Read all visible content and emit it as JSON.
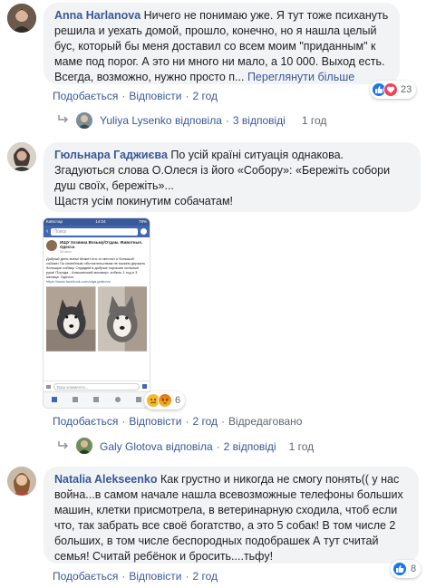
{
  "comments": [
    {
      "author": "Anna Harlanova",
      "text": "Ничего не понимаю уже. Я тут тоже психануть решила и уехать домой, прошло, конечно, но я нашла целый бус, который бы меня доставил со всем моим \"приданным\" к маме под порог. А это ни много ни мало, а 10 000. Выход есть. Всегда, возможно, нужно просто п...",
      "see_more": "Переглянути більше",
      "like": "Подобається",
      "reply": "Відповісти",
      "time": "2 год",
      "reactions_count": "23",
      "reactions": [
        "like-icon",
        "love-icon"
      ],
      "replies": {
        "replier": "Yuliya Lysenko",
        "verb": "відповіла",
        "count": "3 відповіді",
        "time": "1 год"
      }
    },
    {
      "author": "Гюльнара Гаджиєва",
      "text_lines": [
        "По усій країні ситуація однакова.",
        "Згадуються слова О.Олеся із його «Собору»: «Бережіть собори душ своїх, бережіть»...",
        "Щастя усім покинутим собачатам!"
      ],
      "like": "Подобається",
      "reply": "Відповісти",
      "time": "2 год",
      "edited": "Відредаговано",
      "reactions_count": "6",
      "reactions": [
        "sad-icon",
        "angry-icon"
      ],
      "screenshot": {
        "status_left": "Київстар",
        "status_time": "14:04",
        "status_right": "78%",
        "search": "Поиск",
        "group_title": "ИЩУ Хозяина Возьму/Отдам. Животные. Одесса",
        "post_time": "26 мин",
        "post_text": "Добрый день всем! Может кто-то мечтал о большой собаке! По семейным обстоятельствам не можем держать большую собаку. Отдадим в добрые хорошие сильные руки! Порода - Аляскинский маламут, кобель 1 год и 3 месяца. Одесса.",
        "post_link": "https://www.facebook.com/olga.grabova",
        "comment_placeholder": "Ваш коммента..."
      },
      "replies": {
        "replier": "Galy Glotova",
        "verb": "відповіла",
        "count": "2 відповіді",
        "time": "1 год"
      }
    },
    {
      "author": "Natalia Alekseenko",
      "text": "Как грустно и никогда не смогу понять(( у нас война...в самом начале нашла всевозможные телефоны больших машин, клетки присмотрела, в ветеринарную сходила, чтоб если что, так забрать все своё богатство, а это 5 собак! В том числе 2 больших, в том числе беспородных подобрашек А тут считай семья! Считай ребёнок и бросить....тьфу!",
      "like": "Подобається",
      "reply": "Відповісти",
      "time": "2 год",
      "reactions_count": "8",
      "reactions": [
        "like-icon"
      ]
    }
  ],
  "colors": {
    "link": "#385898",
    "bubble": "#f2f3f5",
    "meta": "#606770",
    "like_blue": "#1877f2",
    "love_red": "#f33e58"
  }
}
